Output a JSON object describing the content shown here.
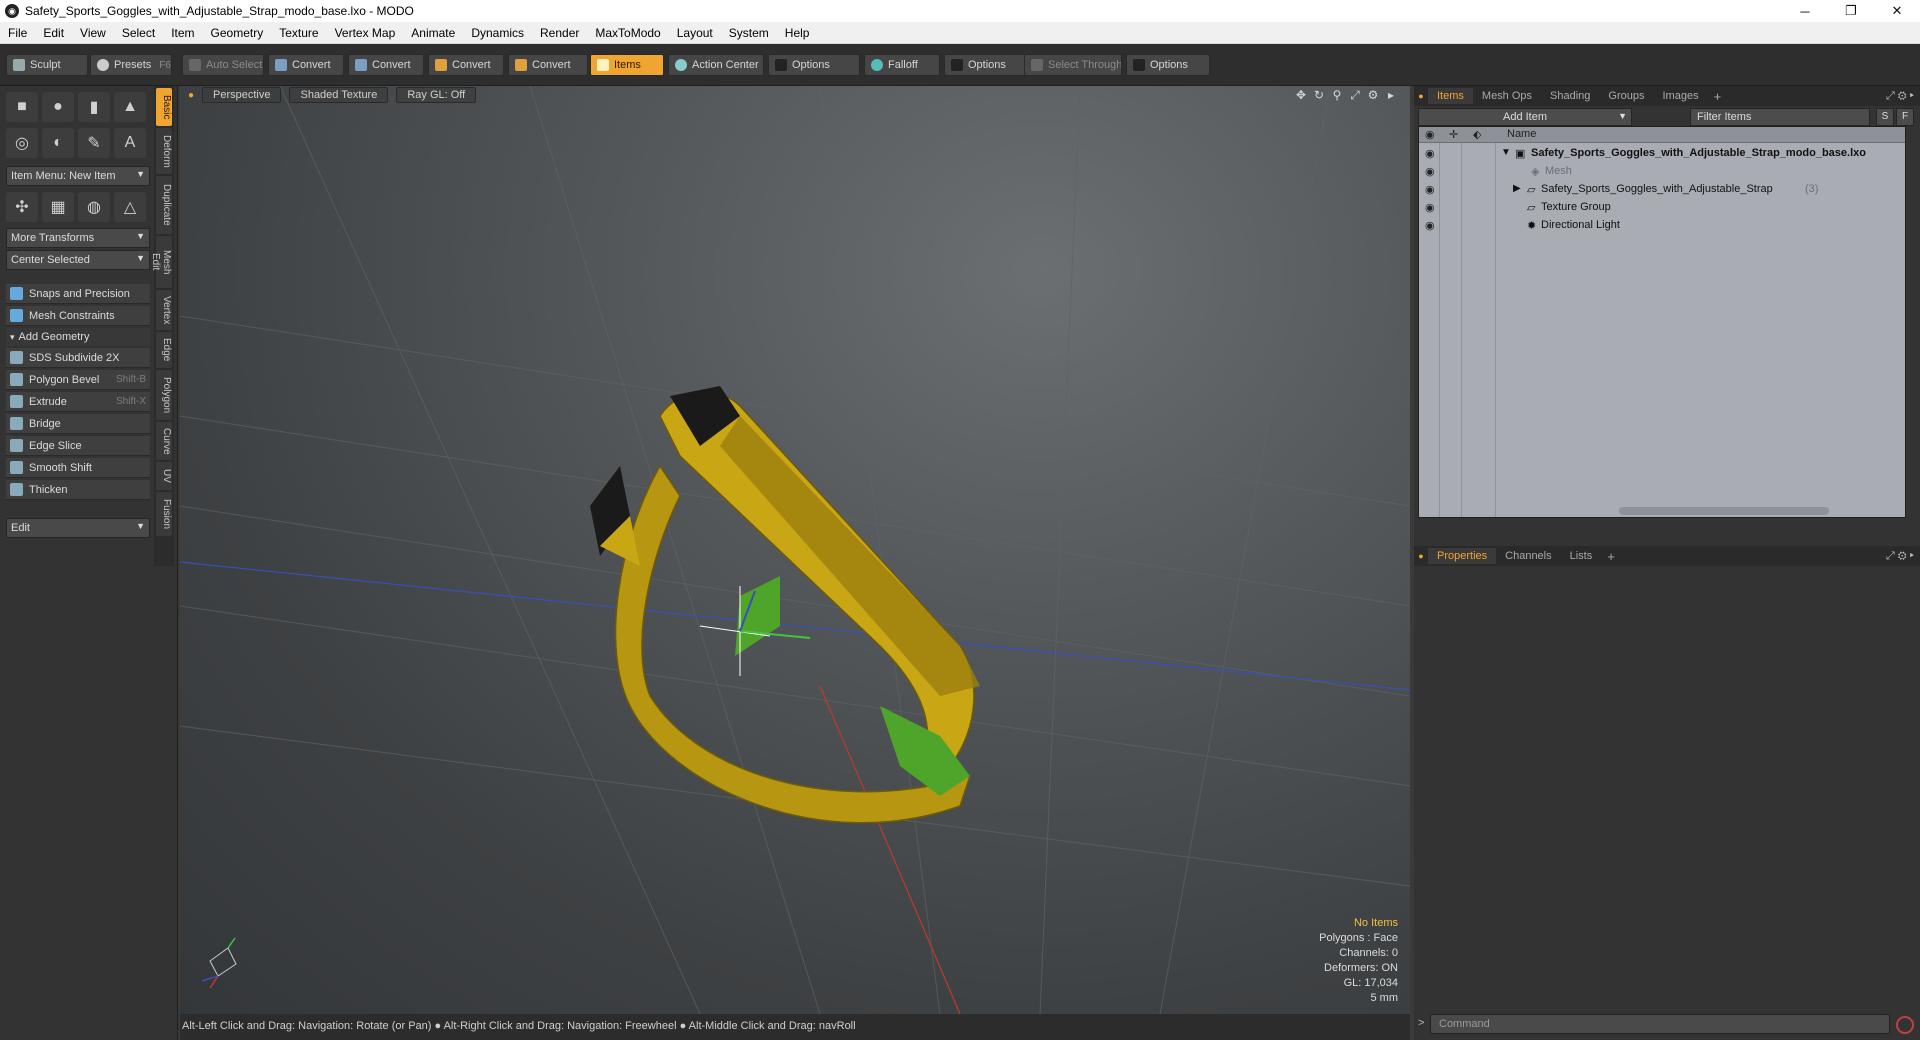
{
  "window": {
    "title": "Safety_Sports_Goggles_with_Adjustable_Strap_modo_base.lxo - MODO",
    "controls": [
      "─",
      "❐",
      "✕"
    ]
  },
  "menu": [
    "File",
    "Edit",
    "View",
    "Select",
    "Item",
    "Geometry",
    "Texture",
    "Vertex Map",
    "Animate",
    "Dynamics",
    "Render",
    "MaxToModo",
    "Layout",
    "System",
    "Help"
  ],
  "toolbar": {
    "sculpt": "Sculpt",
    "presets": "Presets",
    "presets_shortcut": "F6",
    "auto_select": "Auto Select",
    "convert1": "Convert",
    "convert2": "Convert",
    "convert3": "Convert",
    "convert4": "Convert",
    "items": "Items",
    "action_center": "Action Center",
    "options1": "Options",
    "falloff": "Falloff",
    "options2": "Options",
    "select_through": "Select Through",
    "options3": "Options"
  },
  "toolbox": {
    "item_menu": "Item Menu: New Item",
    "more_transforms": "More Transforms",
    "center_selected": "Center Selected",
    "snaps": "Snaps and Precision",
    "mesh_constraints": "Mesh Constraints",
    "add_geometry": "Add Geometry",
    "tools": [
      {
        "label": "SDS Subdivide 2X",
        "shortcut": ""
      },
      {
        "label": "Polygon Bevel",
        "shortcut": "Shift-B"
      },
      {
        "label": "Extrude",
        "shortcut": "Shift-X"
      },
      {
        "label": "Bridge",
        "shortcut": ""
      },
      {
        "label": "Edge Slice",
        "shortcut": ""
      },
      {
        "label": "Smooth Shift",
        "shortcut": ""
      },
      {
        "label": "Thicken",
        "shortcut": ""
      }
    ],
    "edit": "Edit",
    "side_tabs": [
      "Basic",
      "Deform",
      "Duplicate",
      "Mesh Edit",
      "Vertex",
      "Edge",
      "Polygon",
      "Curve",
      "UV",
      "Fusion"
    ]
  },
  "viewport": {
    "view": "Perspective",
    "shading": "Shaded Texture",
    "raygl": "Ray GL: Off",
    "info": {
      "selection": "No Items",
      "polygons": "Polygons : Face",
      "channels": "Channels: 0",
      "deformers": "Deformers: ON",
      "gl": "GL: 17,034",
      "scale": "5 mm"
    },
    "colors": {
      "model": "#c9a614",
      "model_dark": "#8a7010",
      "green": "#4fa52a",
      "axis_x": "#c0392b",
      "axis_z": "#3a4fb8"
    }
  },
  "status": "Alt-Left Click and Drag: Navigation: Rotate (or Pan) ● Alt-Right Click and Drag: Navigation: Freewheel ● Alt-Middle Click and Drag: navRoll",
  "items_panel": {
    "tabs": [
      "Items",
      "Mesh Ops",
      "Shading",
      "Groups",
      "Images"
    ],
    "add_item": "Add Item",
    "filter": "Filter Items",
    "s_btn": "S",
    "f_btn": "F",
    "col_name": "Name",
    "rows": [
      {
        "label": "Safety_Sports_Goggles_with_Adjustable_Strap_modo_base.lxo",
        "count": ""
      },
      {
        "label": "Mesh",
        "count": ""
      },
      {
        "label": "Safety_Sports_Goggles_with_Adjustable_Strap",
        "count": "(3)"
      },
      {
        "label": "Texture Group",
        "count": ""
      },
      {
        "label": "Directional Light",
        "count": ""
      }
    ]
  },
  "props_panel": {
    "tabs": [
      "Properties",
      "Channels",
      "Lists"
    ]
  },
  "command": {
    "prompt": ">",
    "placeholder": "Command"
  }
}
